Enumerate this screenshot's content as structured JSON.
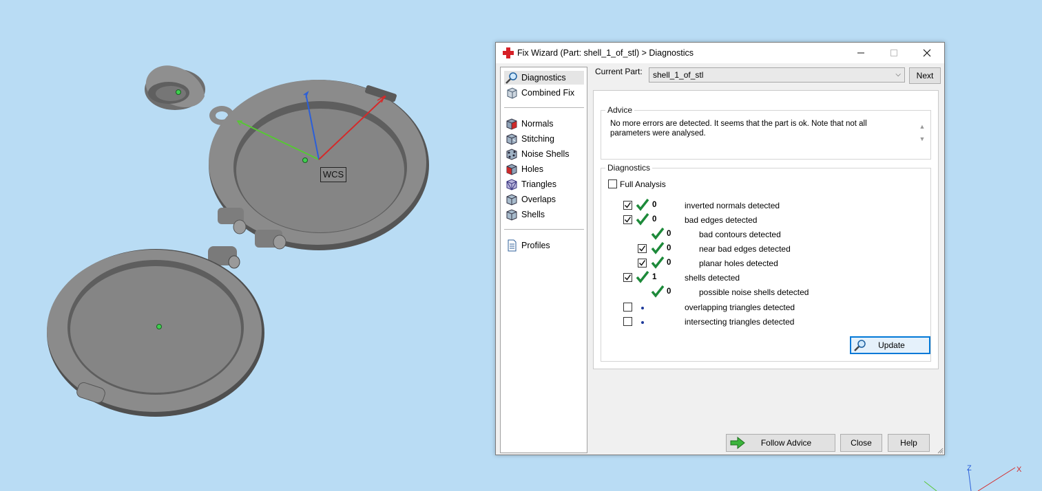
{
  "viewport": {
    "wcs_label": "WCS",
    "axis_colors": {
      "x": "#d42a2a",
      "y": "#57c734",
      "z": "#2b5fd9"
    },
    "triad_labels": {
      "x": "X",
      "z": "Z"
    }
  },
  "dialog": {
    "title": "Fix Wizard (Part: shell_1_of_stl) > Diagnostics",
    "nav": {
      "items": [
        {
          "label": "Diagnostics",
          "icon": "magnifier-icon"
        },
        {
          "label": "Combined Fix",
          "icon": "combined-fix-icon"
        },
        {
          "label": "Normals",
          "icon": "normals-cube-icon"
        },
        {
          "label": "Stitching",
          "icon": "stitching-cube-icon"
        },
        {
          "label": "Noise Shells",
          "icon": "noise-shells-cube-icon"
        },
        {
          "label": "Holes",
          "icon": "holes-cube-icon"
        },
        {
          "label": "Triangles",
          "icon": "triangles-cube-icon"
        },
        {
          "label": "Overlaps",
          "icon": "overlaps-cube-icon"
        },
        {
          "label": "Shells",
          "icon": "shells-cube-icon"
        },
        {
          "label": "Profiles",
          "icon": "document-icon"
        }
      ]
    },
    "current_part_label": "Current Part:",
    "current_part_value": "shell_1_of_stl",
    "next_label": "Next",
    "advice": {
      "title": "Advice",
      "text": "No more errors are detected. It seems that the part is ok. Note that not all parameters were analysed."
    },
    "diagnostics": {
      "title": "Diagnostics",
      "full_analysis_label": "Full Analysis",
      "full_analysis_checked": false,
      "rows": [
        {
          "checked": true,
          "status": "ok",
          "count": "0",
          "label": "inverted normals detected"
        },
        {
          "checked": true,
          "status": "ok",
          "count": "0",
          "label": "bad edges detected"
        },
        {
          "checked": null,
          "status": "ok",
          "count": "0",
          "label": "bad contours detected"
        },
        {
          "checked": true,
          "status": "ok",
          "count": "0",
          "label": "near bad edges detected"
        },
        {
          "checked": true,
          "status": "ok",
          "count": "0",
          "label": "planar holes detected"
        },
        {
          "checked": true,
          "status": "ok",
          "count": "1",
          "label": "shells detected"
        },
        {
          "checked": null,
          "status": "ok",
          "count": "0",
          "label": "possible noise shells detected"
        },
        {
          "checked": false,
          "status": "not-analysed",
          "count": "",
          "label": "overlapping triangles detected"
        },
        {
          "checked": false,
          "status": "not-analysed",
          "count": "",
          "label": "intersecting triangles detected"
        }
      ],
      "update_label": "Update"
    },
    "buttons": {
      "follow_advice": "Follow Advice",
      "close": "Close",
      "help": "Help"
    },
    "colors": {
      "ok_tick": "#1d8a3a",
      "accent": "#0078d7"
    }
  }
}
